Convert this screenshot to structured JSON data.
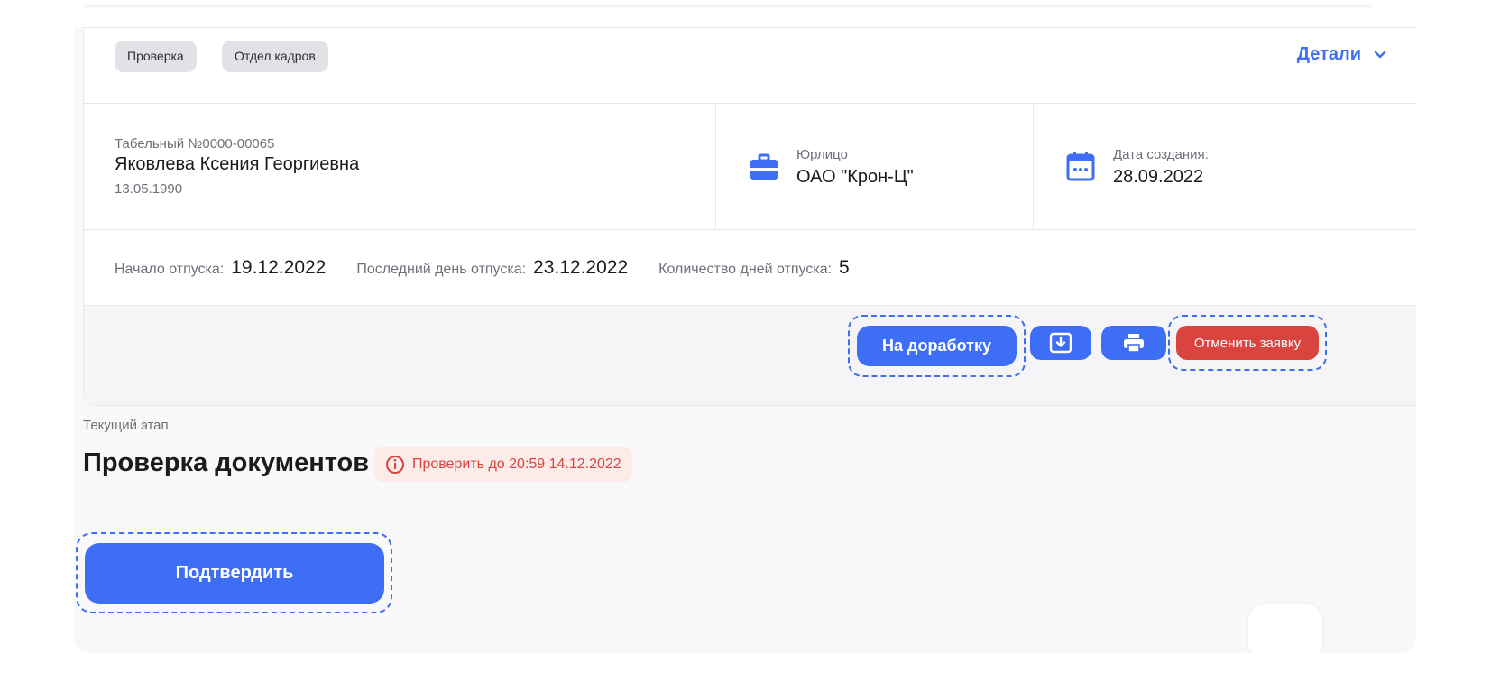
{
  "tags": [
    "Проверка",
    "Отдел кадров"
  ],
  "details_link": {
    "label": "Детали",
    "icon": "chevron-down-icon"
  },
  "employee": {
    "number": "Табельный №0000-00065",
    "name": "Яковлева Ксения Георгиевна",
    "birth_date": "13.05.1990"
  },
  "legal_entity": {
    "label": "Юрлицо",
    "value": "ОАО \"Крон-Ц\"",
    "icon": "briefcase-icon"
  },
  "created": {
    "label": "Дата создания:",
    "value": "28.09.2022",
    "icon": "calendar-icon"
  },
  "vacation": {
    "start_label": "Начало отпуска:",
    "start_value": "19.12.2022",
    "end_label": "Последний день отпуска:",
    "end_value": "23.12.2022",
    "days_label": "Количество дней отпуска:",
    "days_value": "5"
  },
  "actions": {
    "rework_label": "На доработку",
    "download_icon": "download-icon",
    "print_icon": "printer-icon",
    "cancel_label": "Отменить заявку"
  },
  "stage": {
    "label": "Текущий этап",
    "title": "Проверка документов",
    "deadline": "Проверить до 20:59 14.12.2022",
    "deadline_icon": "info-circle-icon"
  },
  "confirm_label": "Подтвердить",
  "colors": {
    "accent": "#3d6ef5",
    "danger": "#d9443f",
    "danger_bg": "#fdebea"
  }
}
